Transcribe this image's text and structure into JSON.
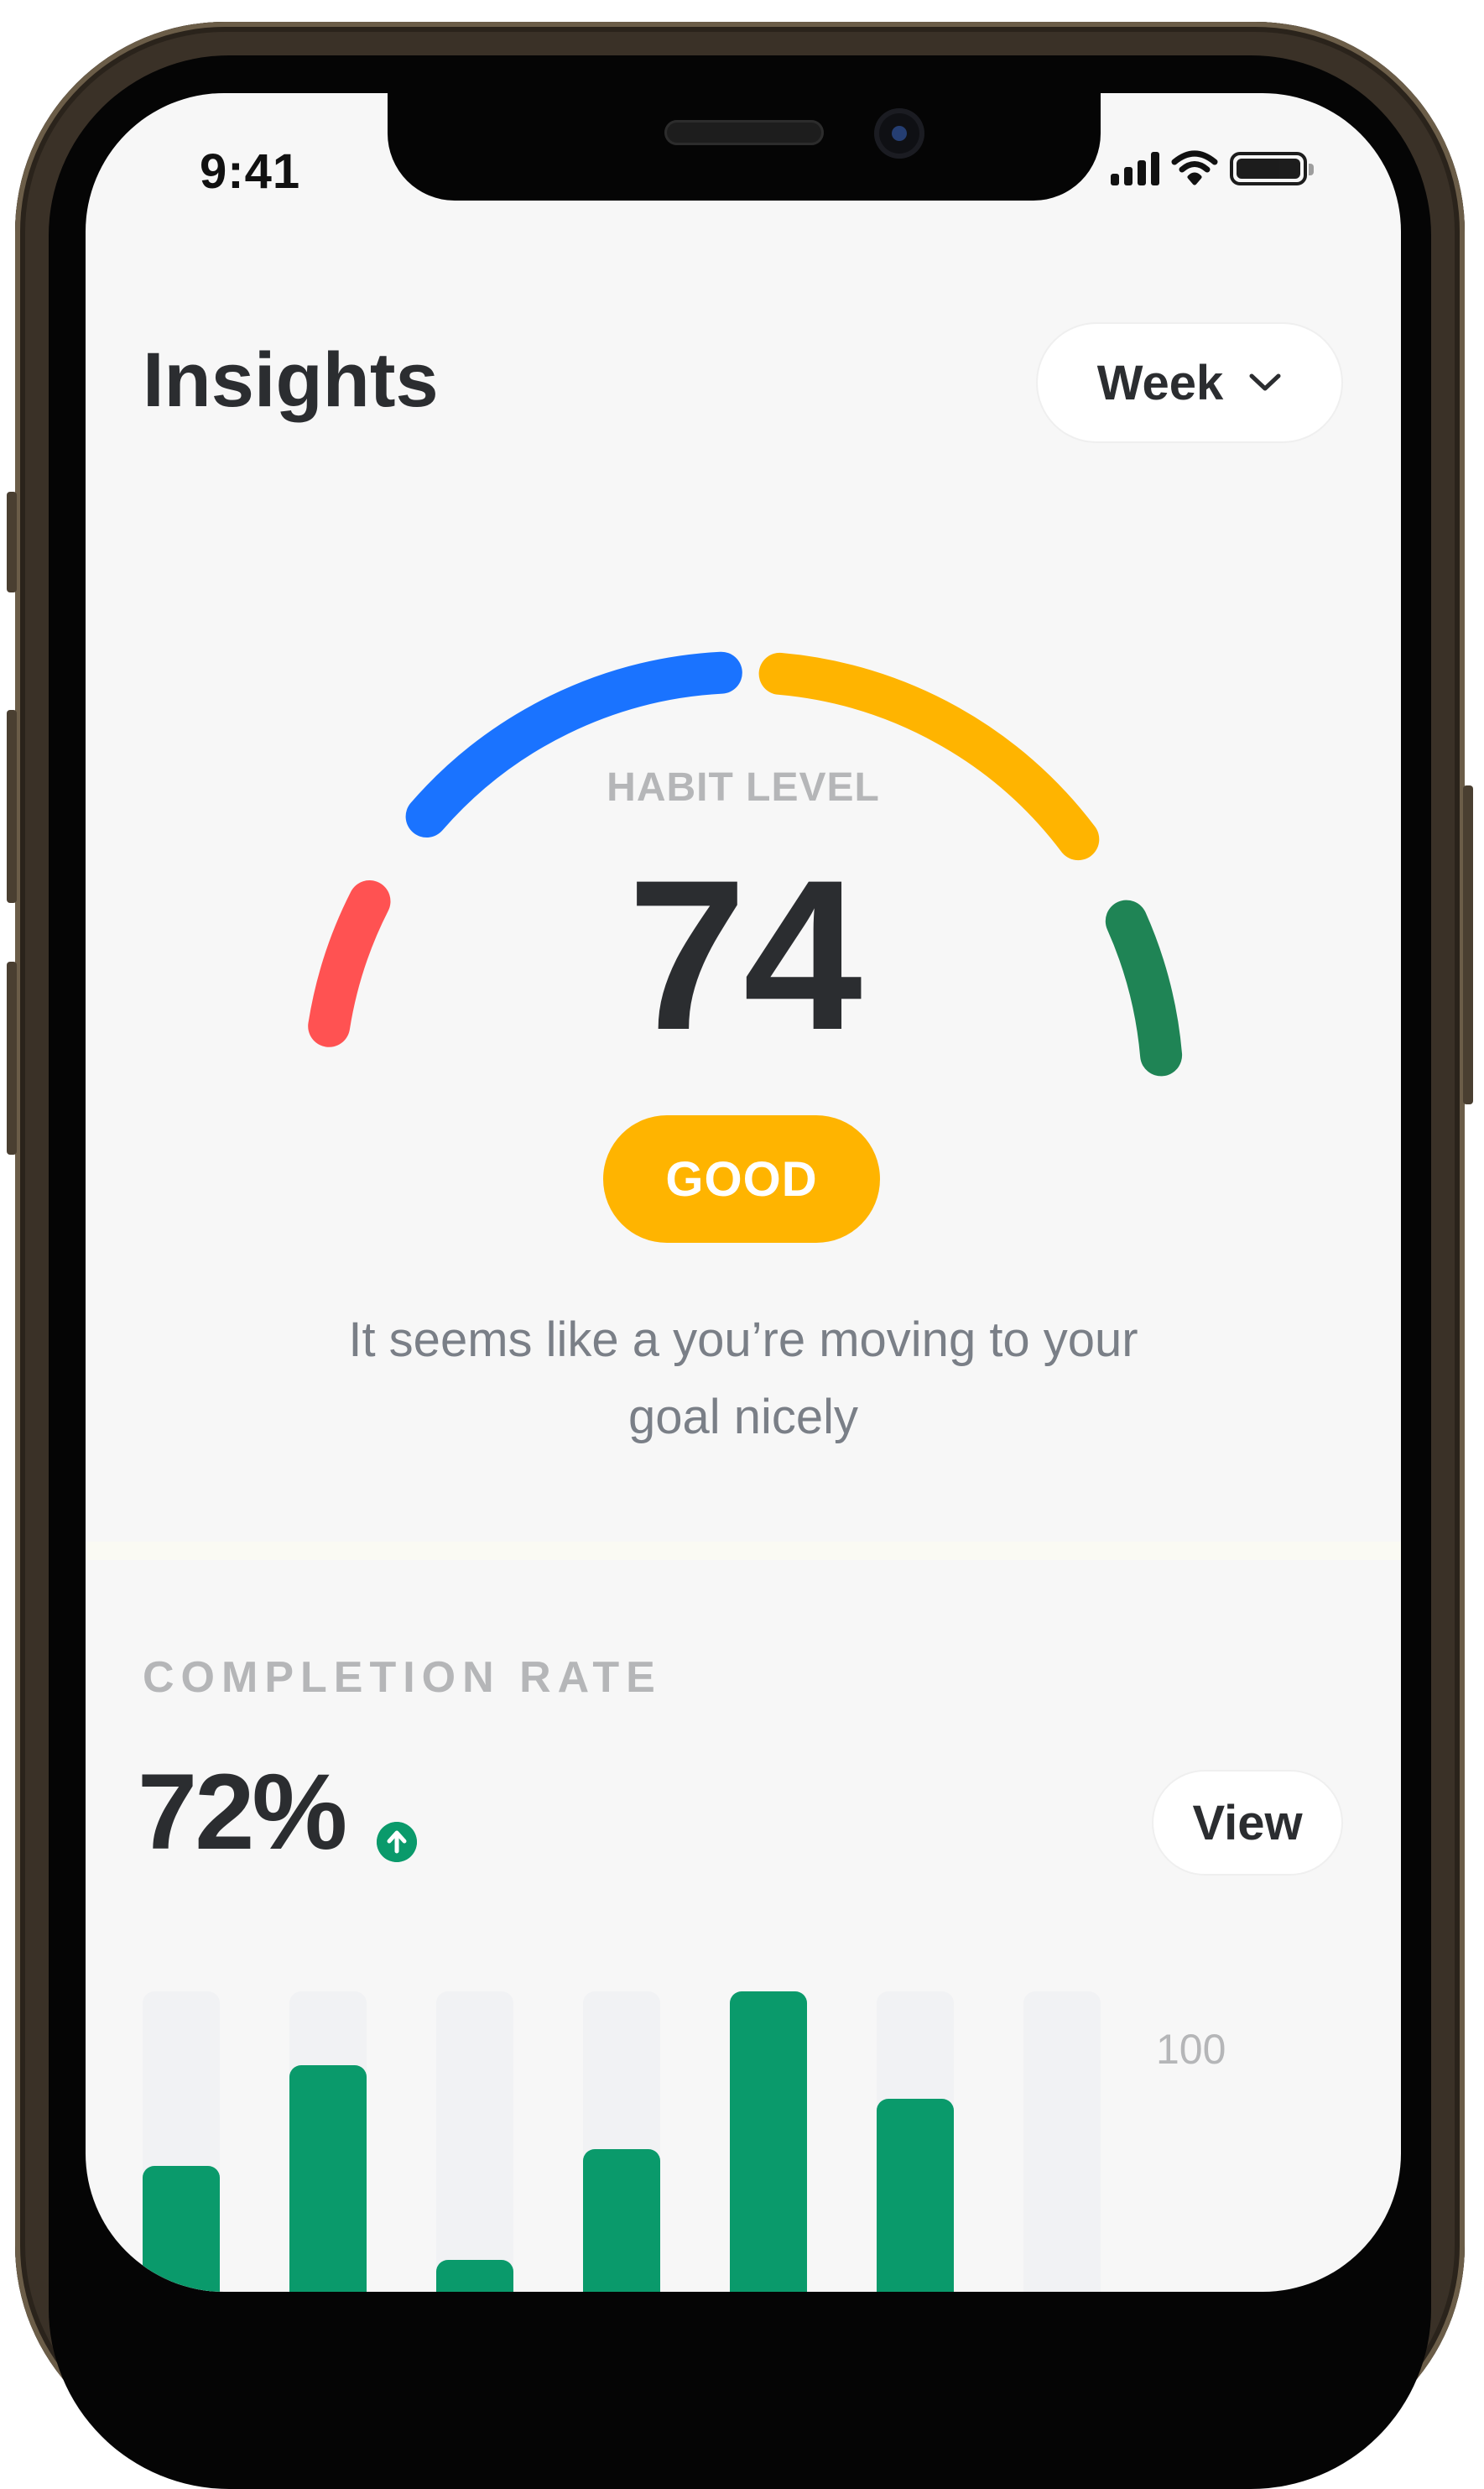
{
  "status_bar": {
    "time": "9:41"
  },
  "header": {
    "title": "Insights",
    "period_select": {
      "selected": "Week"
    }
  },
  "habit_gauge": {
    "label": "HABIT LEVEL",
    "value": "74",
    "status": "GOOD",
    "status_color": "#ffb400",
    "message": "It seems like a you’re moving to your goal nicely",
    "segment_colors": [
      "#ff5252",
      "#1a73ff",
      "#ffb400",
      "#1f8455"
    ]
  },
  "completion": {
    "label": "COMPLETION RATE",
    "value": "72%",
    "trend_icon": "arrow-up-circle-icon",
    "view_label": "View"
  },
  "chart_data": {
    "type": "bar",
    "ylim": [
      0,
      100
    ],
    "y_tick_label": "100",
    "values": [
      48,
      78,
      20,
      53,
      100,
      68,
      0
    ],
    "bar_color": "#0a9a6b",
    "track_color": "#f1f2f4"
  }
}
